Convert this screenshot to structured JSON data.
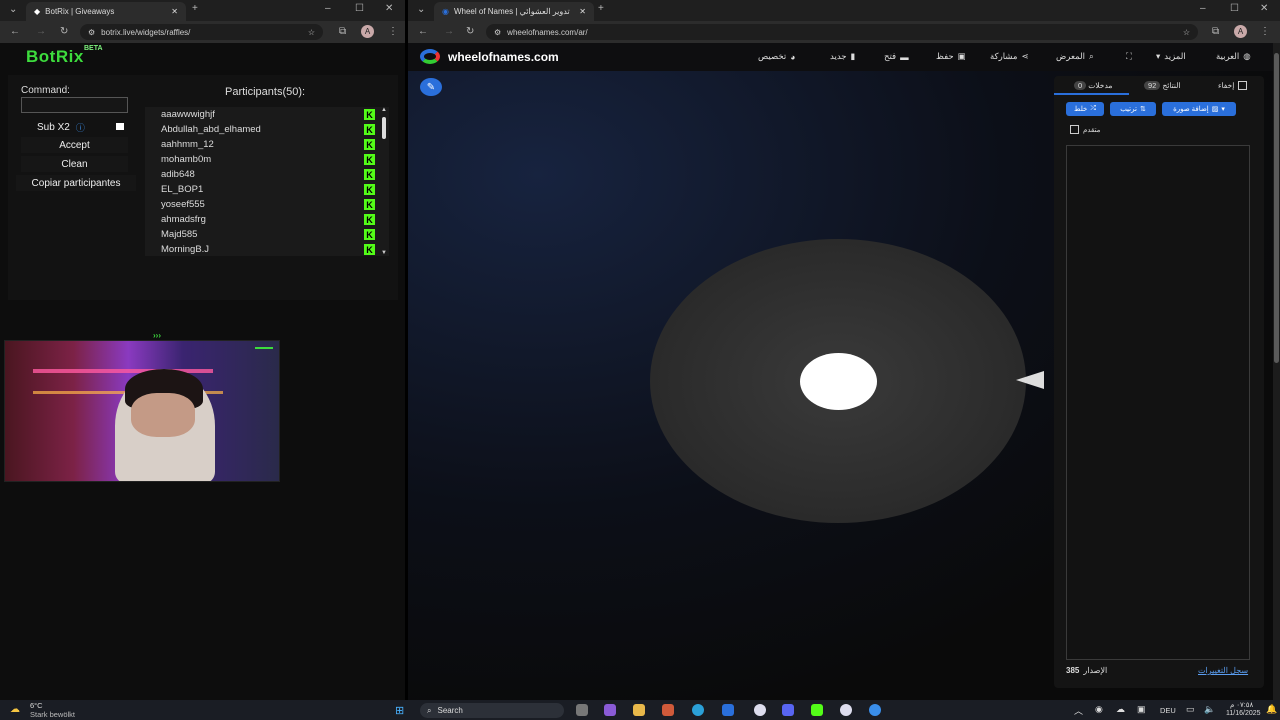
{
  "left_browser": {
    "tab_title": "BotRix | Giveaways",
    "url": "botrix.live/widgets/raffles/",
    "avatar_letter": "A"
  },
  "botrix": {
    "logo": "BotRix",
    "beta": "BETA",
    "command_label": "Command:",
    "sub_label": "Sub X2",
    "accept": "Accept",
    "clean": "Clean",
    "copy": "Copiar participantes",
    "participants_title": "Participants(50):",
    "participants": [
      "aaawwwighjf",
      "Abdullah_abd_elhamed",
      "aahhmm_12",
      "mohamb0m",
      "adib648",
      "EL_BOP1",
      "yoseef555",
      "ahmadsfrg",
      "Majd585",
      "MorningB.J"
    ]
  },
  "camera": {
    "overlay_text": "›››"
  },
  "right_browser": {
    "tab_title": "Wheel of Names | تدوير العشوائي",
    "url": "wheelofnames.com/ar/",
    "avatar_letter": "A"
  },
  "won": {
    "site_name": "wheelofnames.com",
    "menu": [
      "تخصيص",
      "جديد",
      "فتح",
      "حفظ",
      "مشاركة",
      "المعرض",
      "المزيد",
      "العربية"
    ],
    "tab_entries": "مدخلات",
    "tab_entries_count": "0",
    "tab_results": "النتائج",
    "tab_results_count": "92",
    "hide_label": "إخفاء",
    "shuffle": "خلط",
    "sort": "ترتيب",
    "add_image": "إضافة صورة",
    "advanced": "متقدم",
    "version_label": "الإصدار",
    "version_value": "385",
    "changelog": "سجل التغييرات"
  },
  "taskbar": {
    "weather_temp": "6°C",
    "weather_desc": "Stark bewölkt",
    "search": "Search",
    "lang": "DEU",
    "time": "٠٧:٥٨ م",
    "date": "11/16/2025"
  },
  "colors": {
    "botrix_green": "#3ddc3d",
    "kick_green": "#53fc18",
    "won_blue": "#2a6fdb"
  }
}
